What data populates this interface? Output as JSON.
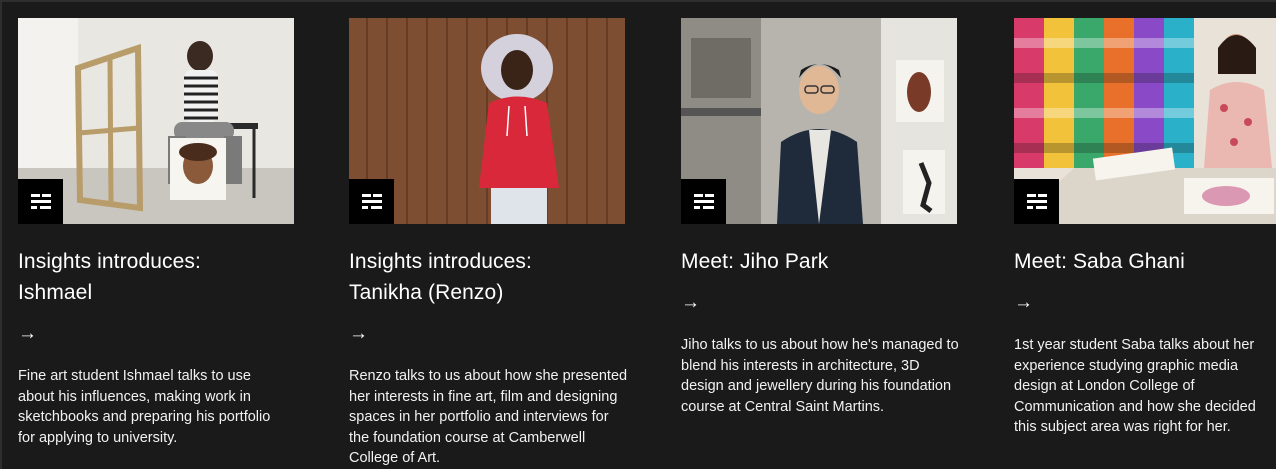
{
  "cards": [
    {
      "title": "Insights introduces: Ishmael",
      "arrow": "→",
      "description": "Fine art student Ishmael talks to use about his influences, making work in sketchbooks and preparing his portfolio for applying to university.",
      "icon": "article-list-icon"
    },
    {
      "title": "Insights introduces: Tanikha (Renzo)",
      "arrow": "→",
      "description": "Renzo talks to us about how she presented her interests in fine art, film and designing spaces in her portfolio and interviews for the foundation course at Camberwell College of Art.",
      "icon": "article-list-icon"
    },
    {
      "title": "Meet: Jiho Park",
      "arrow": "→",
      "description": "Jiho talks to us about how he's managed to blend his interests in architecture, 3D design and jewellery during his foundation course at Central Saint Martins.",
      "icon": "article-list-icon"
    },
    {
      "title": "Meet: Saba Ghani",
      "arrow": "→",
      "description": "1st year student Saba talks about her experience studying graphic media design at London College of Communication and how she decided this subject area was right for her.",
      "icon": "article-list-icon"
    }
  ]
}
